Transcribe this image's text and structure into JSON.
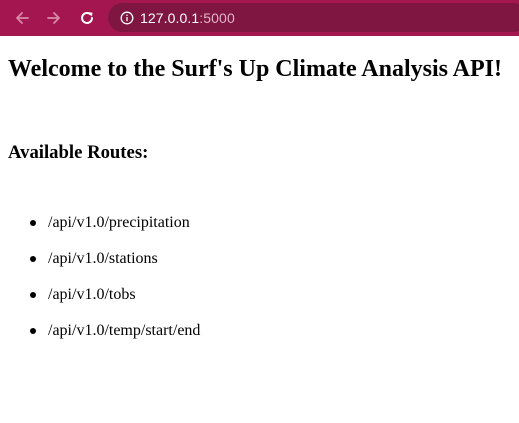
{
  "browser": {
    "url_host": "127.0.0.1",
    "url_port": ":5000",
    "toolbar_color": "#a3164f",
    "address_bar_color": "#7f1641"
  },
  "page": {
    "title": "Welcome to the Surf's Up Climate Analysis API!",
    "routes_heading": "Available Routes:",
    "routes": [
      "/api/v1.0/precipitation",
      "/api/v1.0/stations",
      "/api/v1.0/tobs",
      "/api/v1.0/temp/start/end"
    ]
  }
}
